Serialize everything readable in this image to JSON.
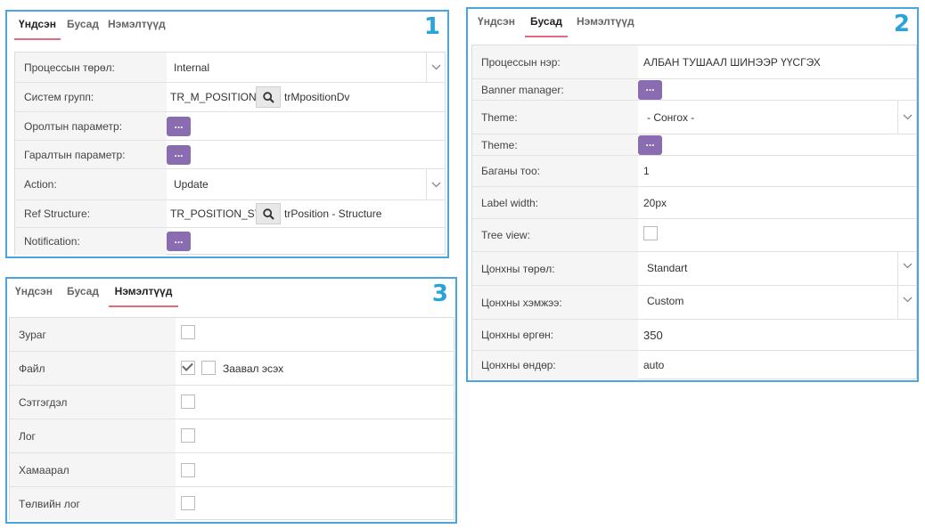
{
  "colors": {
    "panel_border": "#4aa6e0",
    "accent_underline": "#e56a7b",
    "button": "#8a6db0"
  },
  "tabs": {
    "main": "Үндсэн",
    "other": "Бусад",
    "extra": "Нэмэлтүүд"
  },
  "panel1": {
    "number": "1",
    "rows": {
      "process_type": {
        "label": "Процессын төрөл:",
        "value": "Internal"
      },
      "system_group": {
        "label": "Систем групп:",
        "code": "TR_M_POSITION_DV",
        "name": "trMpositionDv"
      },
      "input_param": {
        "label": "Оролтын параметр:",
        "button": "..."
      },
      "output_param": {
        "label": "Гаралтын параметр:",
        "button": "..."
      },
      "action": {
        "label": "Action:",
        "value": "Update"
      },
      "ref_structure": {
        "label": "Ref Structure:",
        "code": "TR_POSITION_STRUC",
        "name": "trPosition - Structure"
      },
      "notification": {
        "label": "Notification:",
        "button": "..."
      }
    }
  },
  "panel2": {
    "number": "2",
    "rows": {
      "process_name": {
        "label": "Процессын нэр:",
        "value": "АЛБАН ТУШААЛ ШИНЭЭР ҮҮСГЭХ"
      },
      "banner_manager": {
        "label": "Banner manager:",
        "button": "..."
      },
      "theme_select": {
        "label": "Theme:",
        "value": "- Сонгох -"
      },
      "theme_button": {
        "label": "Theme:",
        "button": "..."
      },
      "columns": {
        "label": "Баганы тоо:",
        "value": "1"
      },
      "label_width": {
        "label": "Label width:",
        "value": "20px"
      },
      "tree_view": {
        "label": "Tree view:",
        "checked": false
      },
      "window_type": {
        "label": "Цонхны төрөл:",
        "value": "Standart"
      },
      "window_size": {
        "label": "Цонхны хэмжээ:",
        "value": "Custom"
      },
      "window_width": {
        "label": "Цонхны өргөн:",
        "value": "350"
      },
      "window_height": {
        "label": "Цонхны өндөр:",
        "value": "auto"
      }
    }
  },
  "panel3": {
    "number": "3",
    "rows": {
      "image": {
        "label": "Зураг",
        "checked": false
      },
      "file": {
        "label": "Файл",
        "checked": true,
        "required_label": "Заавал эсэх",
        "required_checked": false
      },
      "comment": {
        "label": "Сэтгэгдэл",
        "checked": false
      },
      "log": {
        "label": "Лог",
        "checked": false
      },
      "relation": {
        "label": "Хамаарал",
        "checked": false
      },
      "status_log": {
        "label": "Төлвийн лог",
        "checked": false
      }
    }
  }
}
